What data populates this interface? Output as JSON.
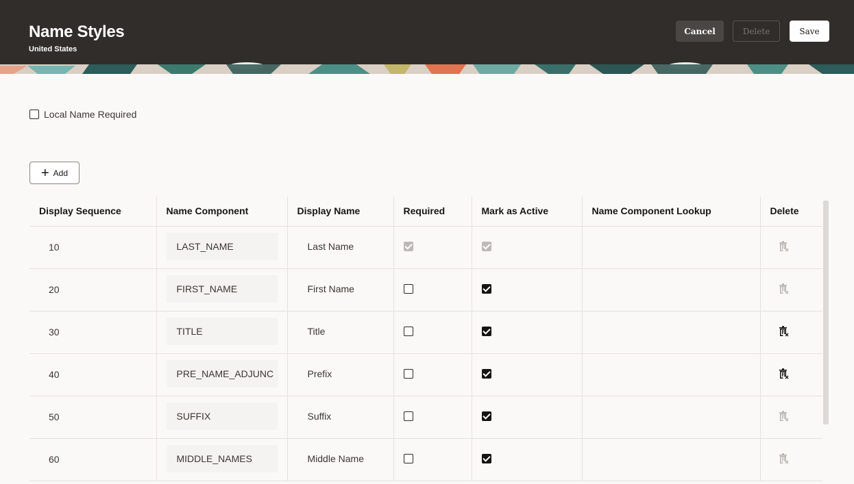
{
  "header": {
    "title": "Name Styles",
    "subtitle": "United States",
    "cancel_label": "Cancel",
    "delete_label": "Delete",
    "save_label": "Save",
    "bg_color": "#312d2a"
  },
  "local_name": {
    "label": "Local Name Required",
    "checked": false
  },
  "add_button": {
    "label": "Add",
    "icon": "plus-icon"
  },
  "table": {
    "columns": [
      "Display Sequence",
      "Name Component",
      "Display Name",
      "Required",
      "Mark as Active",
      "Name Component Lookup",
      "Delete"
    ],
    "rows": [
      {
        "seq": "10",
        "component": "LAST_NAME",
        "display": "Last Name",
        "required": "disabled-checked",
        "active": "disabled-checked",
        "lookup": "",
        "delete_enabled": false
      },
      {
        "seq": "20",
        "component": "FIRST_NAME",
        "display": "First Name",
        "required": "unchecked",
        "active": "checked",
        "lookup": "",
        "delete_enabled": false
      },
      {
        "seq": "30",
        "component": "TITLE",
        "display": "Title",
        "required": "unchecked",
        "active": "checked",
        "lookup": "",
        "delete_enabled": true
      },
      {
        "seq": "40",
        "component": "PRE_NAME_ADJUNC",
        "display": "Prefix",
        "required": "unchecked",
        "active": "checked",
        "lookup": "",
        "delete_enabled": true
      },
      {
        "seq": "50",
        "component": "SUFFIX",
        "display": "Suffix",
        "required": "unchecked",
        "active": "checked",
        "lookup": "",
        "delete_enabled": false
      },
      {
        "seq": "60",
        "component": "MIDDLE_NAMES",
        "display": "Middle Name",
        "required": "unchecked",
        "active": "checked",
        "lookup": "",
        "delete_enabled": false
      }
    ]
  },
  "icons": {
    "delete_row": "trash-icon"
  }
}
